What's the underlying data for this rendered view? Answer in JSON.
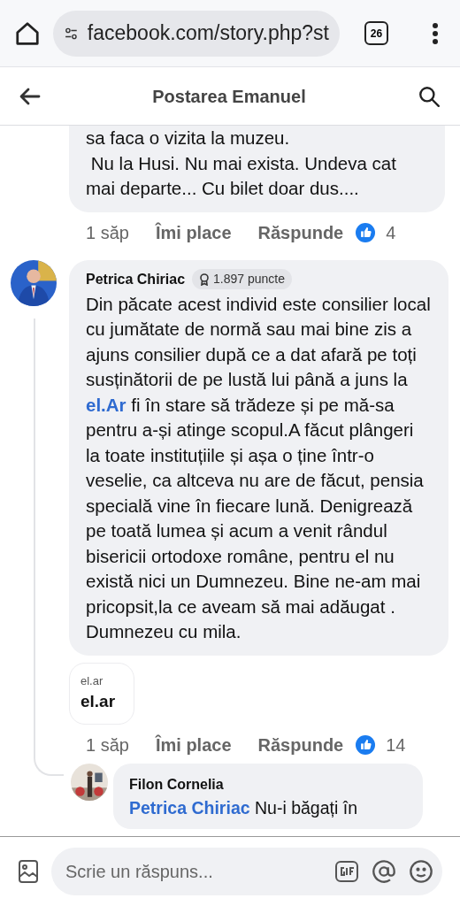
{
  "browser": {
    "url": "facebook.com/story.php?st",
    "tab_count": "26"
  },
  "header": {
    "title": "Postarea Emanuel"
  },
  "comments": [
    {
      "text": [
        {
          "kind": "plain",
          "text": "sa faca o vizita la muzeu.\n Nu la Husi. Nu mai exista. Undeva cat mai departe... Cu bilet doar dus...."
        }
      ],
      "time": "1 săp",
      "like_label": "Îmi place",
      "reply_label": "Răspunde",
      "reaction_count": "4"
    },
    {
      "author": "Petrica Chiriac",
      "badge": "1.897 puncte",
      "text": [
        {
          "kind": "plain",
          "text": "Din păcate acest individ este consilier local cu jumătate de normă sau mai bine zis a ajuns consilier după ce a dat afară pe toți susținătorii de pe lustă lui până a juns la "
        },
        {
          "kind": "link",
          "text": "el.Ar"
        },
        {
          "kind": "plain",
          "text": " fi în stare să trădeze și pe mă-sa  pentru a-și atinge scopul.A făcut plângeri la toate instituțiile și așa o ține într-o veselie, ca altceva nu are de făcut, pensia specială vine în fiecare lună. Denigrează pe toată lumea și acum a venit rândul bisericii ortodoxe române, pentru el nu există nici un Dumnezeu. Bine ne-am mai pricopsit,la ce aveam să mai adăugat .               Dumnezeu cu mila."
        }
      ],
      "link_preview": {
        "domain": "el.ar",
        "title": "el.ar"
      },
      "time": "1 săp",
      "like_label": "Îmi place",
      "reply_label": "Răspunde",
      "reaction_count": "14",
      "replies": [
        {
          "author": "Filon Cornelia",
          "text": [
            {
              "kind": "link",
              "text": "Petrica Chiriac"
            },
            {
              "kind": "plain",
              "text": " Nu-i băgați în"
            }
          ]
        }
      ]
    }
  ],
  "composer": {
    "placeholder": "Scrie un răspuns..."
  }
}
